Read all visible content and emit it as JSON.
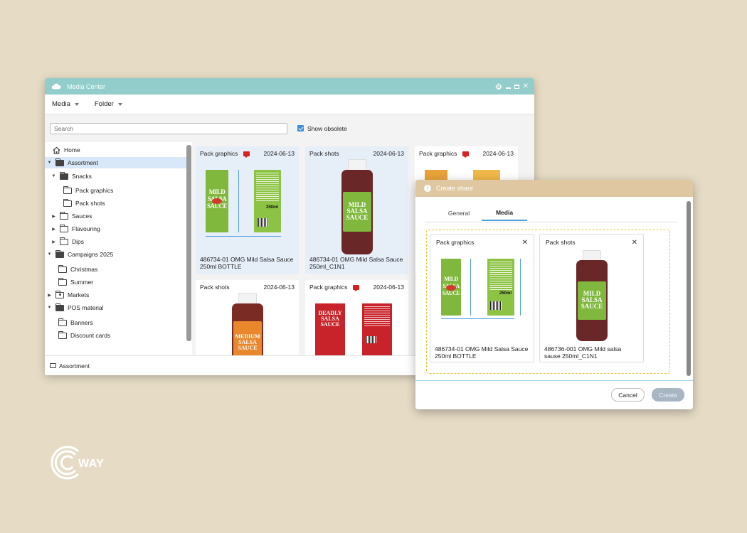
{
  "window": {
    "title": "Media Center",
    "menu": [
      {
        "label": "Media"
      },
      {
        "label": "Folder"
      }
    ],
    "search_placeholder": "Search",
    "show_obsolete_label": "Show obsolete",
    "show_obsolete_checked": true,
    "status_path": "Assortment"
  },
  "tree": {
    "items": [
      {
        "label": "Home",
        "icon": "home-icon"
      },
      {
        "label": "Assortment",
        "icon": "folder-open-icon",
        "selected": true
      },
      {
        "label": "Snacks",
        "icon": "folder-open-icon"
      },
      {
        "label": "Pack graphics",
        "icon": "folder-icon"
      },
      {
        "label": "Pack shots",
        "icon": "folder-icon"
      },
      {
        "label": "Sauces",
        "icon": "folder-icon"
      },
      {
        "label": "Flavouring",
        "icon": "folder-icon"
      },
      {
        "label": "Dips",
        "icon": "folder-icon"
      },
      {
        "label": "Campaigns 2025",
        "icon": "folder-open-icon"
      },
      {
        "label": "Christmas",
        "icon": "folder-icon"
      },
      {
        "label": "Summer",
        "icon": "folder-icon"
      },
      {
        "label": "Markets",
        "icon": "folder-person-icon"
      },
      {
        "label": "POS material",
        "icon": "folder-open-icon"
      },
      {
        "label": "Banners",
        "icon": "folder-icon"
      },
      {
        "label": "Discount cards",
        "icon": "folder-icon"
      }
    ]
  },
  "grid": {
    "cards": [
      {
        "type": "Pack graphics",
        "date": "2024-06-13",
        "comment": true,
        "name": "486734-01 OMG Mild Salsa Sauce 250ml BOTTLE",
        "highlighted": true
      },
      {
        "type": "Pack shots",
        "date": "2024-06-13",
        "comment": false,
        "name": "486734-01 OMG Mild Salsa Sauce 250ml_C1N1",
        "highlighted": true
      },
      {
        "type": "Pack graphics",
        "date": "2024-06-13",
        "comment": true,
        "name": "",
        "highlighted": false
      },
      {
        "type": "Pack shots",
        "date": "2024-06-13",
        "comment": false,
        "name": "",
        "highlighted": false
      },
      {
        "type": "Pack graphics",
        "date": "2024-06-13",
        "comment": true,
        "name": "",
        "highlighted": false
      }
    ]
  },
  "product_art": {
    "mild_title": "MILD SALSA SAUCE",
    "mild_title_bottle": "MILD SALSA SAUCE",
    "medium_title": "MEDIUM SALSA SAUCE",
    "deadly_title": "DEADLY SALSA SAUCE",
    "volume": "250ml",
    "volume_small": "250 ml"
  },
  "dialog": {
    "title": "Create share",
    "tabs": [
      {
        "label": "General"
      },
      {
        "label": "Media",
        "active": true
      }
    ],
    "items": [
      {
        "type": "Pack graphics",
        "name": "486734-01 OMG Mild Salsa Sauce 250ml BOTTLE"
      },
      {
        "type": "Pack shots",
        "name": "486736-001 OMG Mild salsa sause 250ml_C1N1"
      }
    ],
    "cancel_label": "Cancel",
    "create_label": "Create",
    "create_enabled": false
  },
  "brand": {
    "logo_text": "WAY",
    "logo_mark": "C"
  },
  "colors": {
    "titlebar": "#93cdcb",
    "dialog_titlebar": "#dfc7a1",
    "background": "#e6dcc6",
    "accent": "#3f8fd6",
    "comment": "#d72020",
    "dropzone_border": "#e8c43c"
  }
}
